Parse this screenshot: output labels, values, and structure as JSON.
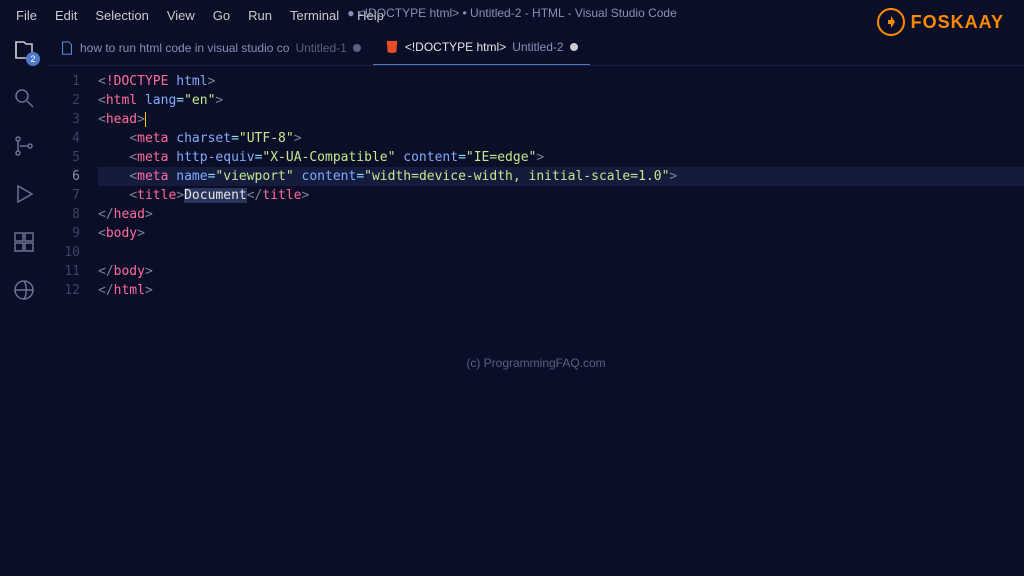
{
  "window_title": "● <!DOCTYPE html> • Untitled-2 - HTML - Visual Studio Code",
  "logo_text": "FOSKAAY",
  "menubar": [
    "File",
    "Edit",
    "Selection",
    "View",
    "Go",
    "Run",
    "Terminal",
    "Help"
  ],
  "activitybar": {
    "explorer_badge": "2"
  },
  "tabs": [
    {
      "title": "how to run html code in visual studio co",
      "sub": "Untitled-1",
      "modified": true,
      "active": false,
      "icon": "file"
    },
    {
      "title": "<!DOCTYPE html>",
      "sub": "Untitled-2",
      "modified": true,
      "active": true,
      "icon": "html"
    }
  ],
  "line_numbers": [
    "1",
    "2",
    "3",
    "4",
    "5",
    "6",
    "7",
    "8",
    "9",
    "10",
    "11",
    "12"
  ],
  "active_line": 6,
  "code": {
    "l1": {
      "p0": "<",
      "p1": "!DOCTYPE",
      "p2": " ",
      "p3": "html",
      "p4": ">"
    },
    "l2": {
      "p0": "<",
      "p1": "html",
      "p2": " ",
      "p3": "lang",
      "p4": "=",
      "p5": "\"en\"",
      "p6": ">"
    },
    "l3": {
      "p0": "<",
      "p1": "head",
      "p2": ">"
    },
    "l4": {
      "p0": "    ",
      "p1": "<",
      "p2": "meta",
      "p3": " ",
      "p4": "charset",
      "p5": "=",
      "p6": "\"UTF-8\"",
      "p7": ">"
    },
    "l5": {
      "p0": "    ",
      "p1": "<",
      "p2": "meta",
      "p3": " ",
      "p4": "http-equiv",
      "p5": "=",
      "p6": "\"X-UA-Compatible\"",
      "p7": " ",
      "p8": "content",
      "p9": "=",
      "p10": "\"IE=edge\"",
      "p11": ">"
    },
    "l6": {
      "p0": "    ",
      "p1": "<",
      "p2": "meta",
      "p3": " ",
      "p4": "name",
      "p5": "=",
      "p6": "\"viewport\"",
      "p7": " ",
      "p8": "content",
      "p9": "=",
      "p10": "\"width=device-width, initial-scale=1.0\"",
      "p11": ">"
    },
    "l7": {
      "p0": "    ",
      "p1": "<",
      "p2": "title",
      "p3": ">",
      "p4": "Document",
      "p5": "</",
      "p6": "title",
      "p7": ">"
    },
    "l8": {
      "p0": "</",
      "p1": "head",
      "p2": ">"
    },
    "l9": {
      "p0": "<",
      "p1": "body",
      "p2": ">"
    },
    "l10": {
      "p0": "    "
    },
    "l11": {
      "p0": "</",
      "p1": "body",
      "p2": ">"
    },
    "l12": {
      "p0": "</",
      "p1": "html",
      "p2": ">"
    }
  },
  "watermark": "(c) ProgrammingFAQ.com"
}
